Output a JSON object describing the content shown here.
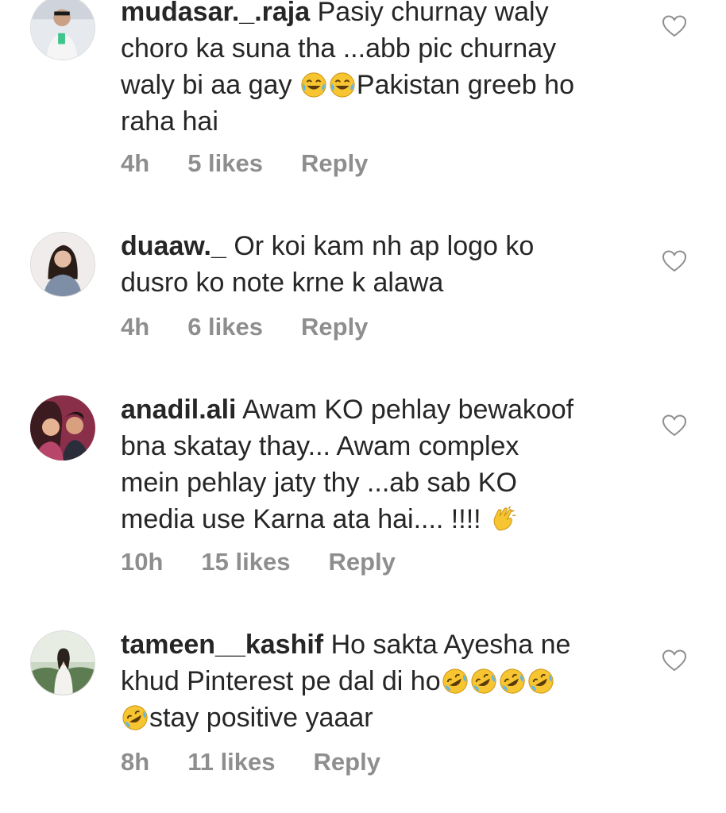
{
  "comments": [
    {
      "username": "mudasar._.raja",
      "text_parts": [
        " Pasiy churnay waly\nchoro ka suna tha ...abb pic churnay\nwaly bi aa gay ",
        "joy-emoji",
        "joy-emoji",
        "Pakistan greeb ho\nraha hai"
      ],
      "text_a": " Pasiy churnay waly\nchoro ka suna tha ...abb pic churnay\nwaly bi aa gay ",
      "text_b": "Pakistan greeb ho\nraha hai",
      "time": "4h",
      "likes": "5 likes",
      "reply": "Reply"
    },
    {
      "username": "duaaw._",
      "text_a": " Or koi kam nh ap logo ko\ndusro ko note krne k alawa",
      "time": "4h",
      "likes": "6 likes",
      "reply": "Reply"
    },
    {
      "username": "anadil.ali",
      "text_a": " Awam KO pehlay bewakoof\nbna skatay thay... Awam complex\nmein pehlay jaty thy ...ab sab KO\nmedia use Karna ata hai.... !!!! ",
      "time": "10h",
      "likes": "15 likes",
      "reply": "Reply"
    },
    {
      "username": "tameen__kashif",
      "text_a": " Ho sakta Ayesha ne\nkhud Pinterest pe dal di ho",
      "text_b": "stay positive yaaar",
      "time": "8h",
      "likes": "11 likes",
      "reply": "Reply"
    }
  ],
  "icons": {
    "like": "heart-outline-icon",
    "emoji_joy": "face-with-tears-of-joy",
    "emoji_rofl": "rolling-on-floor-laughing",
    "emoji_clap": "clapping-hands"
  },
  "colors": {
    "text": "#262626",
    "meta": "#8e8e8e",
    "emoji": "#f7c531"
  }
}
